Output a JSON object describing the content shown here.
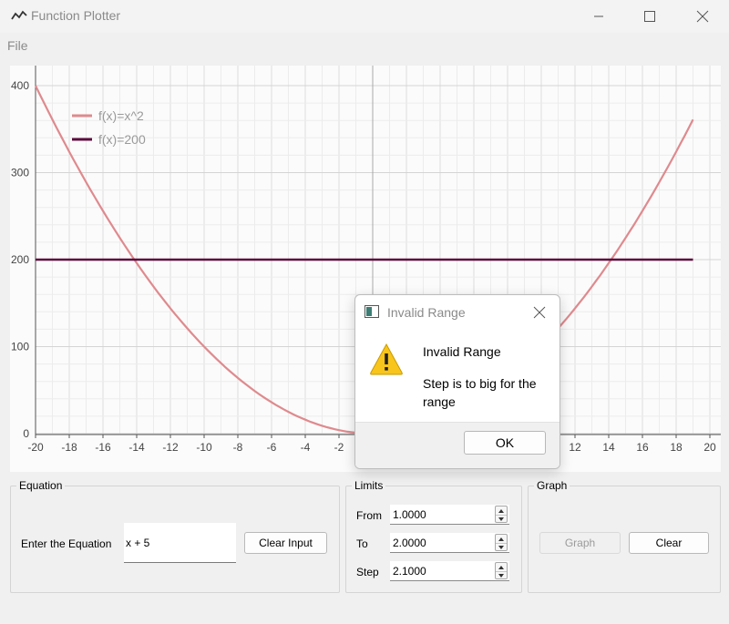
{
  "window": {
    "title": "Function Plotter"
  },
  "menu": {
    "file": "File"
  },
  "colors": {
    "series1": "#df8a8e",
    "series2": "#5c0b3c",
    "warning": "#f8c51c"
  },
  "chart_data": {
    "type": "line",
    "xlim": [
      -20,
      20
    ],
    "ylim": [
      0,
      400
    ],
    "x_ticks": [
      "-20",
      "-18",
      "-16",
      "-14",
      "-12",
      "-10",
      "-8",
      "-6",
      "-4",
      "-2",
      "0",
      "2",
      "4",
      "6",
      "8",
      "10",
      "12",
      "14",
      "16",
      "18",
      "20"
    ],
    "y_ticks": [
      "400",
      "300",
      "200",
      "100",
      "0"
    ],
    "grid": true,
    "legend_position": "top-left",
    "series": [
      {
        "name": "f(x)=x^2",
        "function": "x^2",
        "x_range": [
          -20,
          19
        ],
        "points": [
          [
            -20,
            400
          ],
          [
            -16,
            256
          ],
          [
            -14,
            196
          ],
          [
            -10,
            100
          ],
          [
            -6,
            36
          ],
          [
            -2,
            4
          ],
          [
            0,
            0
          ],
          [
            6,
            36
          ],
          [
            10,
            100
          ],
          [
            14,
            196
          ],
          [
            18,
            324
          ],
          [
            19,
            361
          ]
        ]
      },
      {
        "name": "f(x)=200",
        "function": "200",
        "x_range": [
          -20,
          19
        ],
        "points": [
          [
            -20,
            200
          ],
          [
            19,
            200
          ]
        ]
      }
    ]
  },
  "equation": {
    "group_title": "Equation",
    "label": "Enter the Equation",
    "value": "x + 5",
    "clear_button": "Clear Input"
  },
  "limits": {
    "group_title": "Limits",
    "from_label": "From",
    "from_value": "1.0000",
    "to_label": "To",
    "to_value": "2.0000",
    "step_label": "Step",
    "step_value": "2.1000"
  },
  "graph": {
    "group_title": "Graph",
    "graph_button": "Graph",
    "clear_button": "Clear"
  },
  "dialog": {
    "title": "Invalid Range",
    "heading": "Invalid Range",
    "message": "Step is to big for the range",
    "ok_button": "OK"
  }
}
